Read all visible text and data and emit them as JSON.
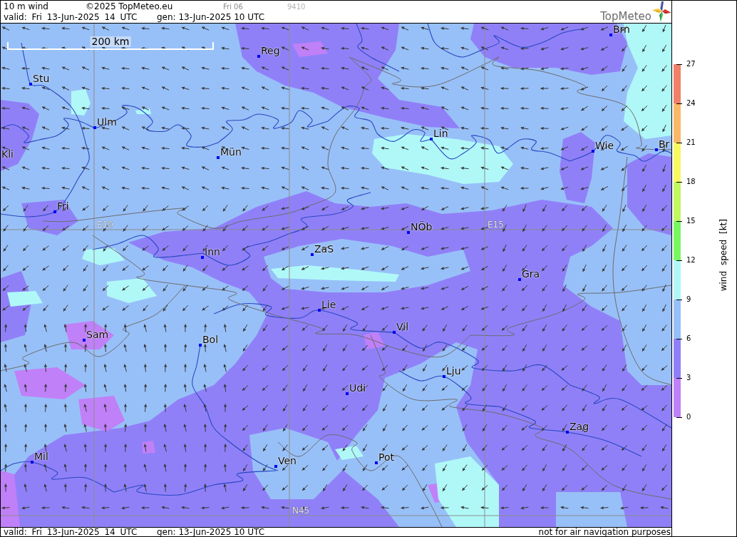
{
  "header": {
    "title": "10 m wind",
    "copyright": "©2025 TopMeteo.eu",
    "run": "Fri 06",
    "code": "9410",
    "valid": "valid: Fri 13-Jun-2025 14 UTC",
    "generated": "gen: 13-Jun-2025 10 UTC",
    "logo": "TopMeteo"
  },
  "map": {
    "scale_bar": "200 km",
    "grid_labels": [
      "E10",
      "E15",
      "N45"
    ],
    "cities": [
      "Brn",
      "Reg",
      "Stu",
      "Ulm",
      "Lin",
      "Br",
      "Wie",
      "Mün",
      "Kli",
      "Fri",
      "NÖb",
      "ZaS",
      "Inn",
      "Gra",
      "Lie",
      "Vil",
      "Sam",
      "Bol",
      "Lju",
      "Udi",
      "Zag",
      "Mil",
      "Pot",
      "Ven"
    ]
  },
  "legend": {
    "title": "wind speed [kt]",
    "ticks": [
      "27",
      "24",
      "21",
      "18",
      "15",
      "12",
      "9",
      "6",
      "3",
      "0"
    ],
    "bands": [
      {
        "color": "#f08068"
      },
      {
        "color": "#f8b868"
      },
      {
        "color": "#f8f860"
      },
      {
        "color": "#c0f860"
      },
      {
        "color": "#78f860"
      },
      {
        "color": "#b0f8f8"
      },
      {
        "color": "#98c0f8"
      },
      {
        "color": "#9080f8"
      },
      {
        "color": "#c080f8"
      }
    ]
  },
  "footer": {
    "valid": "valid: Fri 13-Jun-2025 14 UTC",
    "generated": "gen: 13-Jun-2025 10 UTC",
    "disclaimer": "not for air navigation purposes"
  }
}
